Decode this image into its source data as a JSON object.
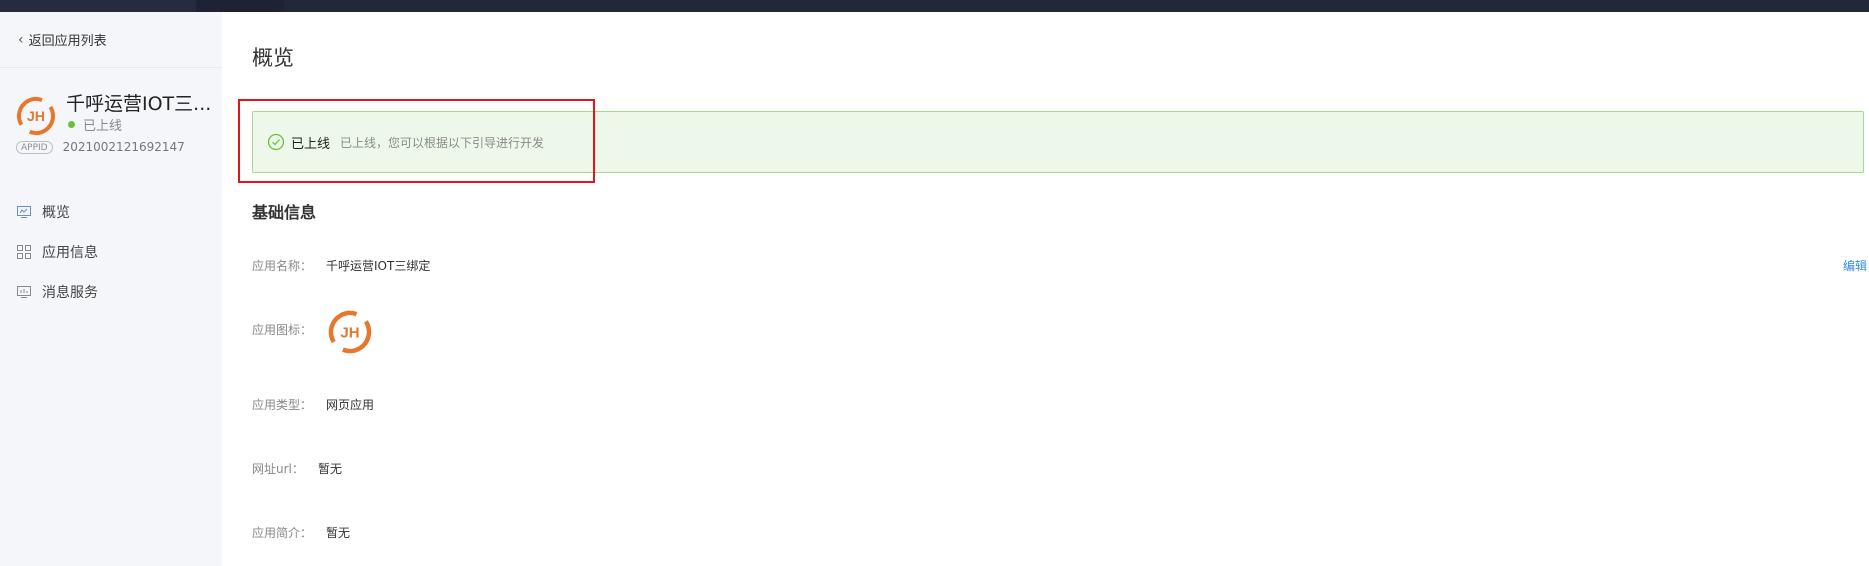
{
  "nav": {
    "back_label": "返回应用列表",
    "items": [
      {
        "label": "概览",
        "icon": "monitor-icon"
      },
      {
        "label": "应用信息",
        "icon": "grid-icon"
      },
      {
        "label": "消息服务",
        "icon": "chart-icon"
      }
    ]
  },
  "app": {
    "name": "千呼运营IOT三...",
    "status": "已上线",
    "appid_badge": "APPID",
    "appid": "2021002121692147",
    "logo_color": "#e8762c"
  },
  "main": {
    "title": "概览",
    "alert": {
      "title": "已上线",
      "description": "已上线，您可以根据以下引导进行开发"
    },
    "section_title": "基础信息",
    "edit_label": "编辑",
    "fields": [
      {
        "label": "应用名称：",
        "value": "千呼运营IOT三绑定"
      },
      {
        "label": "应用图标：",
        "value": ""
      },
      {
        "label": "应用类型：",
        "value": "网页应用"
      },
      {
        "label": "网址url：",
        "value": "暂无"
      },
      {
        "label": "应用简介：",
        "value": "暂无"
      }
    ]
  },
  "colors": {
    "accent": "#2d8cf0",
    "success": "#67c23a",
    "highlight": "#e3141c"
  }
}
